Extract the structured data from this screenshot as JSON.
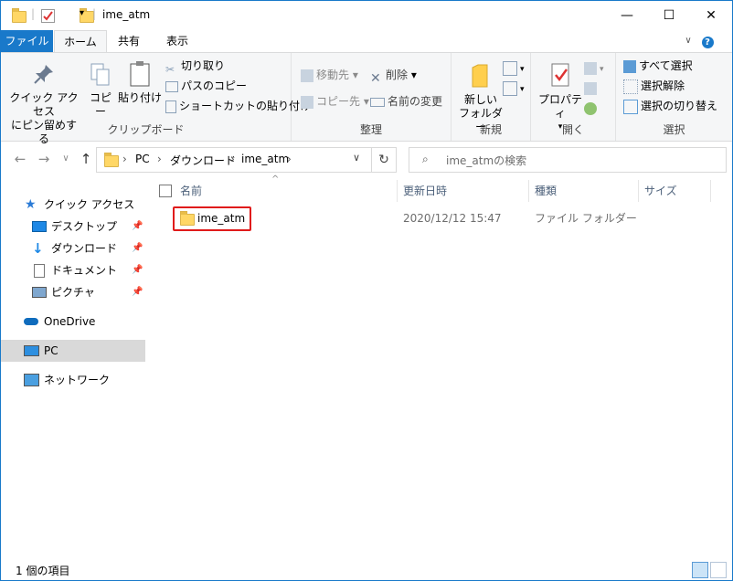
{
  "window": {
    "title": "ime_atm",
    "minimize": "—",
    "maximize": "☐",
    "close": "✕"
  },
  "tabs": {
    "file": "ファイル",
    "home": "ホーム",
    "share": "共有",
    "view": "表示"
  },
  "ribbon": {
    "clipboard": {
      "pin_quick_access": [
        "クイック アクセス",
        "にピン留めする"
      ],
      "copy": "コピー",
      "paste": "貼り付け",
      "cut": "切り取り",
      "copy_path": "パスのコピー",
      "paste_shortcut": "ショートカットの貼り付け",
      "label": "クリップボード"
    },
    "organize": {
      "move_to": "移動先",
      "copy_to": "コピー先",
      "delete": "削除",
      "rename": "名前の変更",
      "label": "整理"
    },
    "new": {
      "new_folder": [
        "新しい",
        "フォルダー"
      ],
      "label": "新規"
    },
    "open": {
      "properties": "プロパティ",
      "label": "開く"
    },
    "select": {
      "select_all": "すべて選択",
      "select_none": "選択解除",
      "invert_selection": "選択の切り替え",
      "label": "選択"
    }
  },
  "address": {
    "path": [
      "PC",
      "ダウンロード",
      "ime_atm"
    ],
    "search_placeholder": "ime_atmの検索"
  },
  "nav_pane": {
    "quick_access": "クイック アクセス",
    "items": [
      {
        "label": "デスクトップ",
        "pinned": true
      },
      {
        "label": "ダウンロード",
        "pinned": true
      },
      {
        "label": "ドキュメント",
        "pinned": true
      },
      {
        "label": "ピクチャ",
        "pinned": true
      }
    ],
    "onedrive": "OneDrive",
    "pc": "PC",
    "network": "ネットワーク"
  },
  "columns": {
    "name": "名前",
    "modified": "更新日時",
    "type": "種類",
    "size": "サイズ"
  },
  "files": [
    {
      "name": "ime_atm",
      "modified": "2020/12/12 15:47",
      "type": "ファイル フォルダー",
      "size": ""
    }
  ],
  "status": {
    "item_count": "1 個の項目"
  }
}
